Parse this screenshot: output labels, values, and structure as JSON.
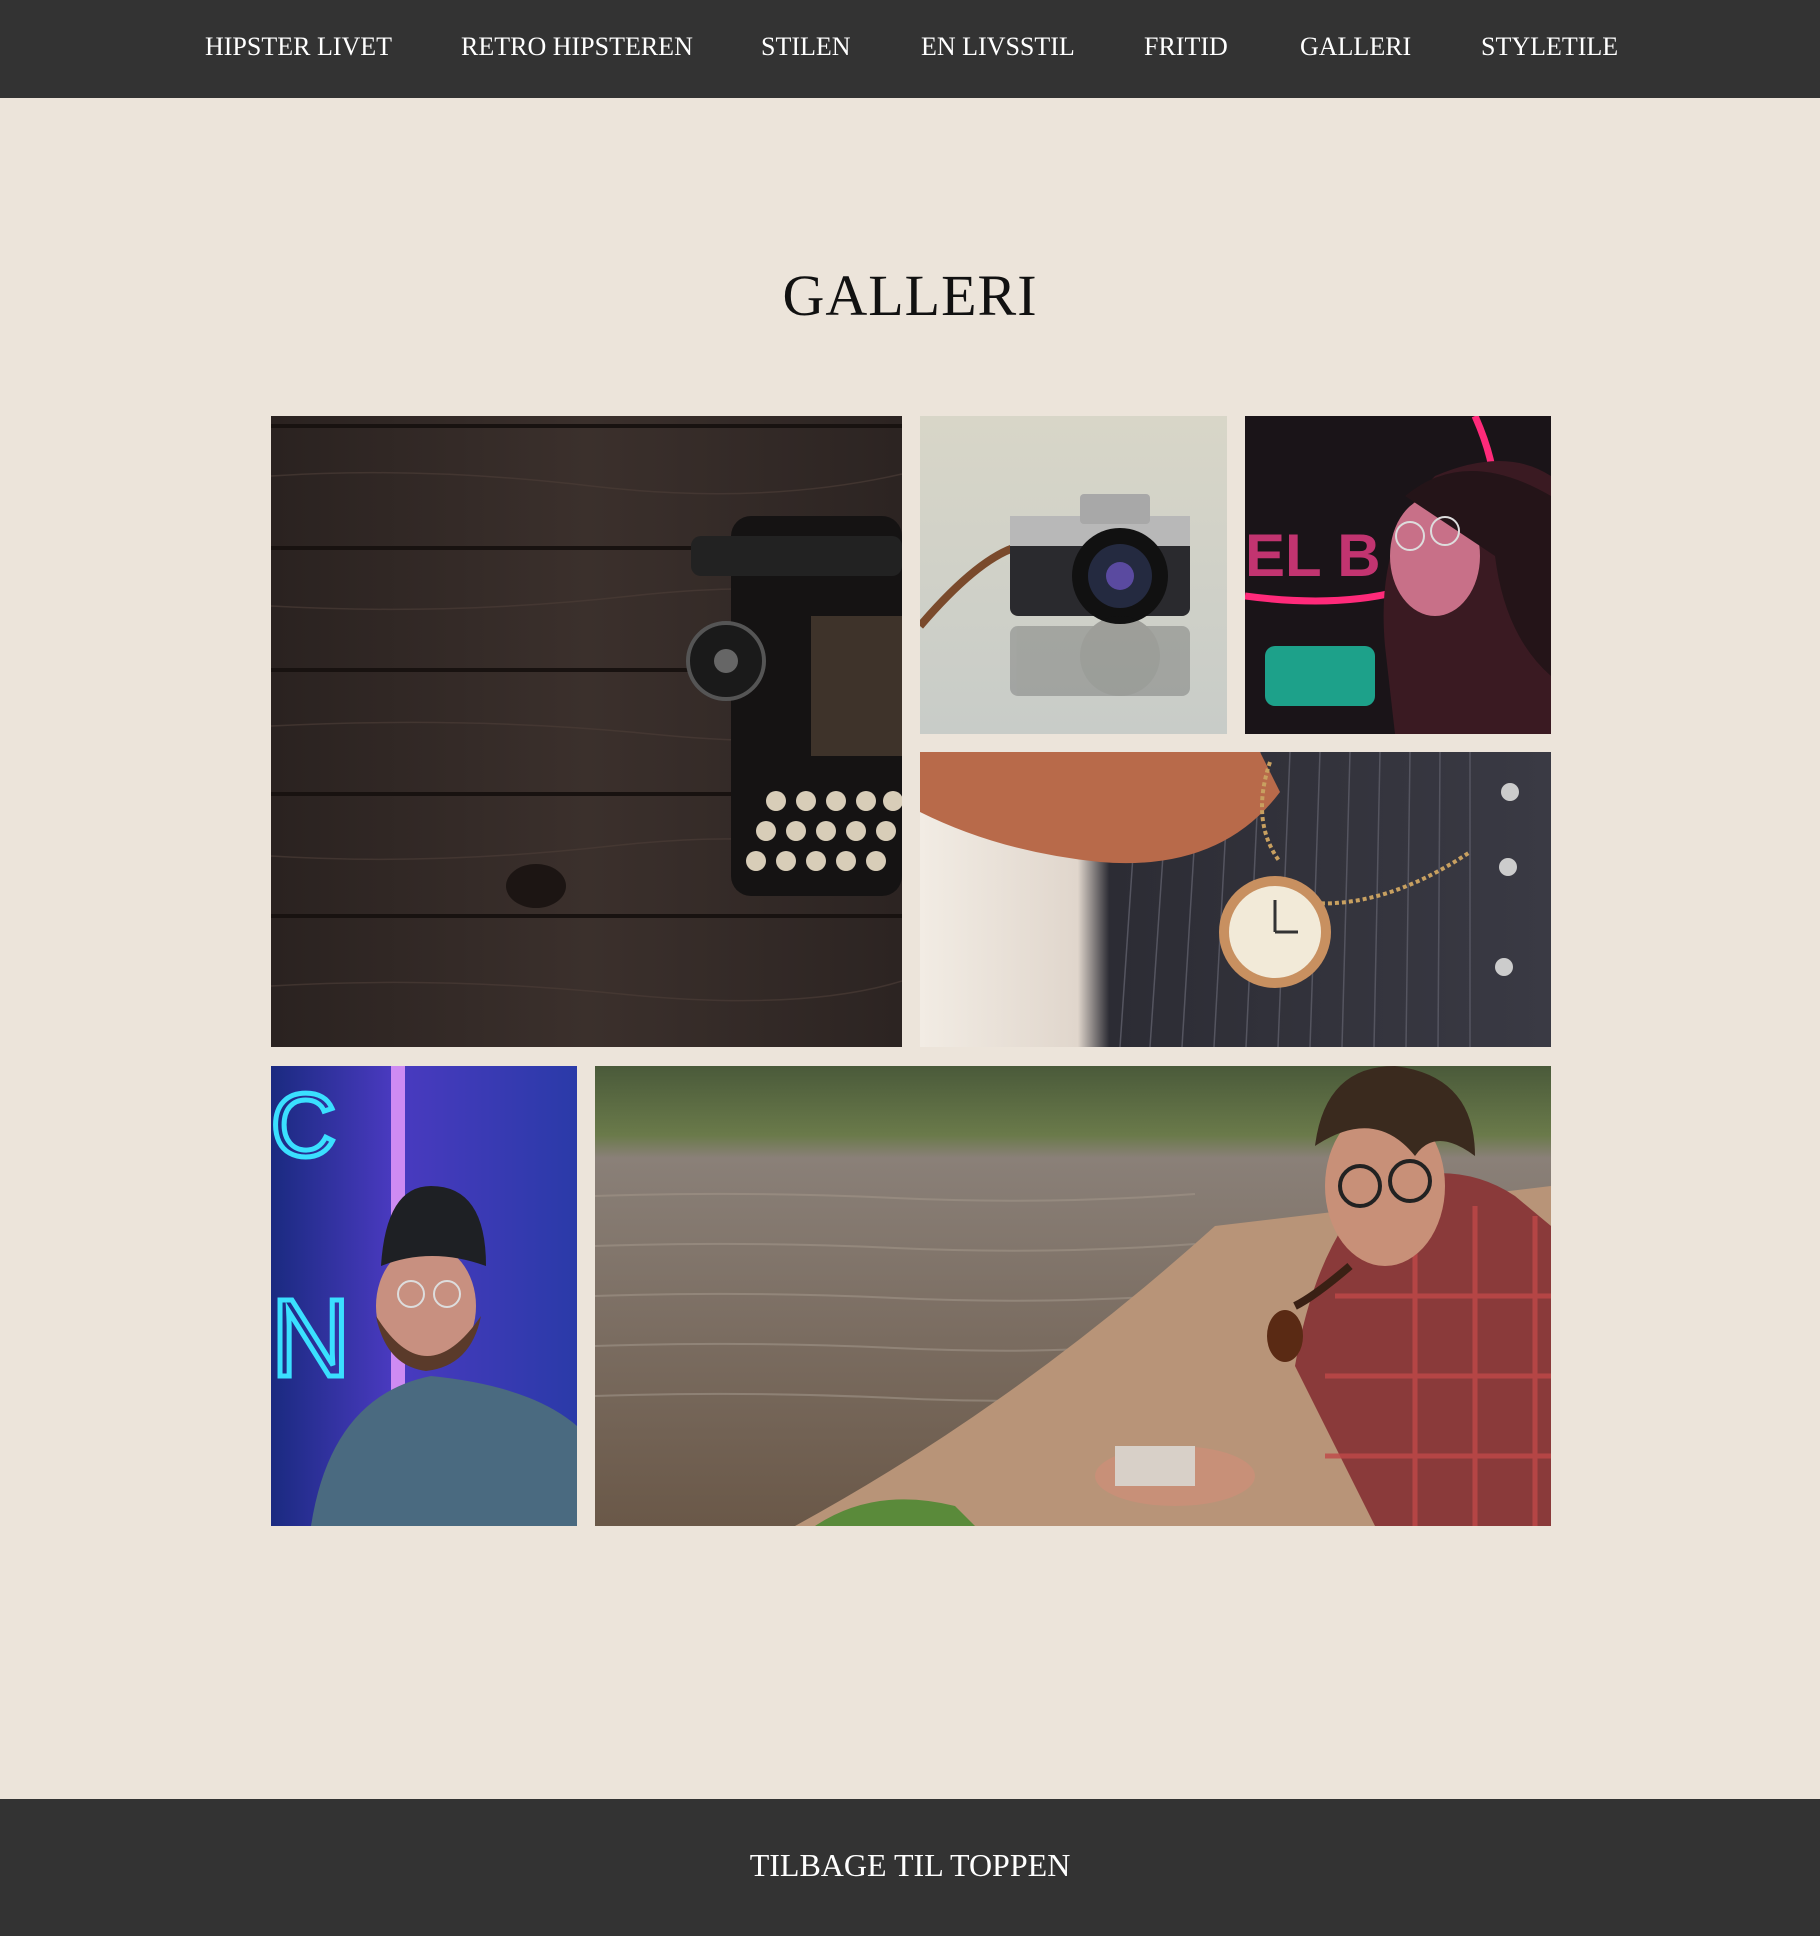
{
  "nav": {
    "items": [
      {
        "label": "HIPSTER LIVET"
      },
      {
        "label": "RETRO HIPSTEREN"
      },
      {
        "label": "STILEN"
      },
      {
        "label": "EN LIVSSTIL"
      },
      {
        "label": "FRITID"
      },
      {
        "label": "GALLERI"
      },
      {
        "label": "STYLETILE"
      }
    ]
  },
  "page": {
    "title": "GALLERI"
  },
  "gallery": {
    "photos": [
      {
        "icon": "typewriter-photo"
      },
      {
        "icon": "camera-photo"
      },
      {
        "icon": "neon-woman-photo"
      },
      {
        "icon": "pocket-watch-photo"
      },
      {
        "icon": "neon-beanie-man-photo"
      },
      {
        "icon": "pipe-man-lake-photo"
      }
    ]
  },
  "footer": {
    "back_to_top": "TILBAGE TIL TOPPEN"
  },
  "colors": {
    "nav_bg": "#333333",
    "page_bg": "#ece4da",
    "text_dark": "#111111",
    "text_light": "#ffffff"
  }
}
